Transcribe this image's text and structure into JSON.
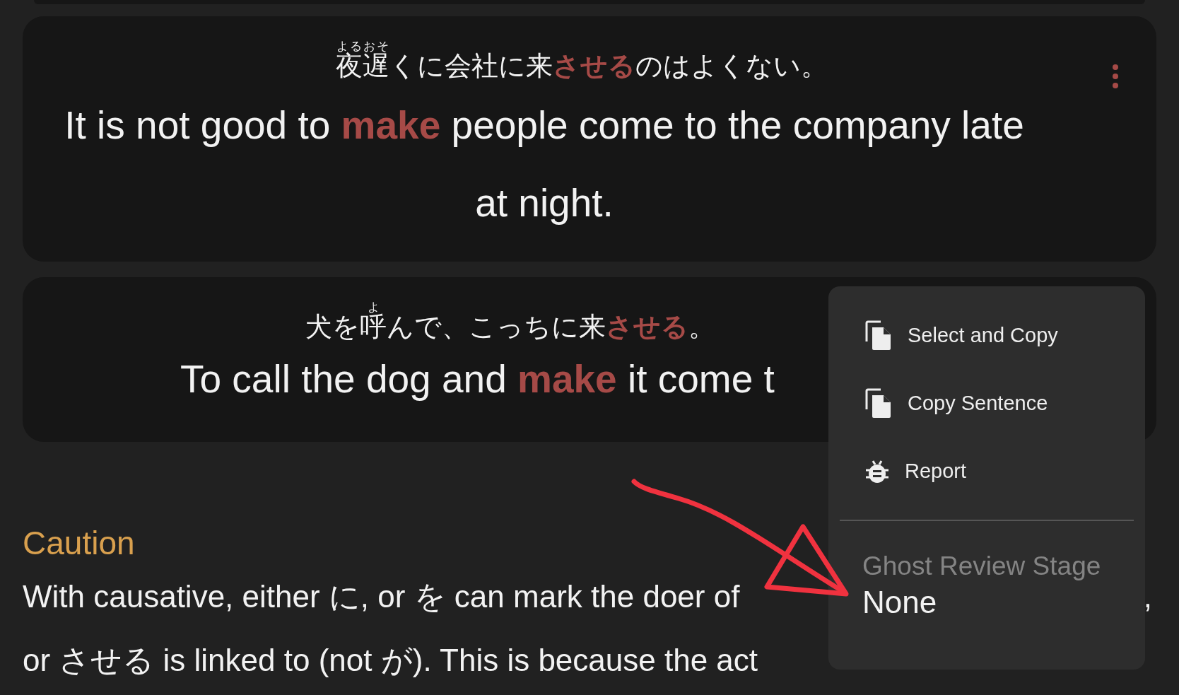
{
  "cards": [
    {
      "menu_icon_visible": true,
      "japanese": [
        {
          "text": "夜遅",
          "ruby": "よるおそ",
          "highlight": false
        },
        {
          "text": "くに会社に来",
          "highlight": false
        },
        {
          "text": "させる",
          "highlight": true
        },
        {
          "text": "のはよくない。",
          "highlight": false
        }
      ],
      "english": [
        {
          "text": "It is not good to ",
          "highlight": false
        },
        {
          "text": "make",
          "highlight": true
        },
        {
          "text": " people come to the company late at night.",
          "highlight": false
        }
      ]
    },
    {
      "menu_icon_visible": false,
      "japanese": [
        {
          "text": "犬を",
          "highlight": false
        },
        {
          "text": "呼",
          "ruby": "よ",
          "highlight": false
        },
        {
          "text": "んで、こっちに来",
          "highlight": false
        },
        {
          "text": "させる",
          "highlight": true
        },
        {
          "text": "。",
          "highlight": false
        }
      ],
      "english": [
        {
          "text": "To call the dog and ",
          "highlight": false
        },
        {
          "text": "make",
          "highlight": true
        },
        {
          "text": " it come t",
          "highlight": false
        }
      ]
    }
  ],
  "caution": {
    "heading": "Caution",
    "lines": [
      {
        "left": "With causative, either に, or を can mark the doer of",
        "right": ","
      },
      {
        "left": "or させる is linked to (not が). This is because the act"
      }
    ]
  },
  "context_menu": {
    "items": [
      {
        "kind": "copy",
        "label": "Select and Copy"
      },
      {
        "kind": "copy",
        "label": "Copy Sentence"
      },
      {
        "kind": "report",
        "label": "Report"
      }
    ],
    "setting": {
      "label": "Ghost Review Stage",
      "value": "None"
    }
  }
}
